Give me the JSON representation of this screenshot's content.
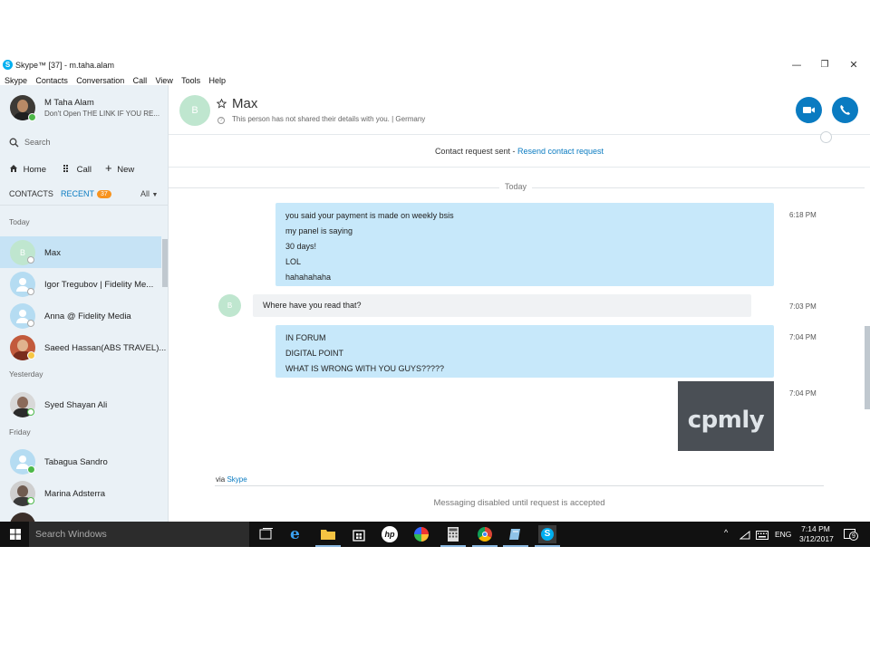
{
  "window": {
    "title": "Skype™ [37] - m.taha.alam",
    "minimize": "—",
    "restore": "❐",
    "close": "✕"
  },
  "menu": [
    "Skype",
    "Contacts",
    "Conversation",
    "Call",
    "View",
    "Tools",
    "Help"
  ],
  "sidebar": {
    "profile_name": "M Taha Alam",
    "profile_mood": "Don't Open THE LINK IF YOU RE...",
    "search_placeholder": "Search",
    "nav": {
      "home": "Home",
      "call": "Call",
      "new": "New"
    },
    "tabs": {
      "contacts": "CONTACTS",
      "recent": "RECENT",
      "recent_count": "37",
      "filter": "All"
    },
    "sections": {
      "today": "Today",
      "yesterday": "Yesterday",
      "friday": "Friday"
    },
    "contacts": [
      {
        "name": "Max",
        "initial": "B"
      },
      {
        "name": "Igor Tregubov | Fidelity Me..."
      },
      {
        "name": "Anna @ Fidelity Media"
      },
      {
        "name": "Saeed Hassan(ABS TRAVEL)..."
      },
      {
        "name": "Syed Shayan Ali"
      },
      {
        "name": "Tabagua Sandro"
      },
      {
        "name": "Marina Adsterra"
      }
    ]
  },
  "chat": {
    "avatar_initial": "B",
    "title": "Max",
    "subtitle": "This person has not shared their details with you.  |  Germany",
    "request_text": "Contact request sent - ",
    "request_link": "Resend contact request",
    "day_label": "Today",
    "messages": [
      {
        "lines": [
          "you said your payment is made on weekly bsis",
          "my panel is saying",
          "30 days!",
          "LOL",
          "hahahahaha"
        ],
        "time": "6:18 PM"
      },
      {
        "lines": [
          "Where have you read that?"
        ],
        "time": "7:03 PM",
        "initial": "B"
      },
      {
        "lines": [
          "IN FORUM",
          "DIGITAL POINT",
          "WHAT IS WRONG WITH YOU GUYS?????"
        ],
        "time": "7:04 PM"
      },
      {
        "image_text": "cpmly",
        "time": "7:04 PM"
      }
    ],
    "via_prefix": "via ",
    "via_link": "Skype",
    "disabled_text": "Messaging disabled until request is accepted"
  },
  "taskbar": {
    "search_placeholder": "Search Windows",
    "language": "ENG",
    "time": "7:14 PM",
    "date": "3/12/2017",
    "notification_count": "9"
  },
  "colors": {
    "accent": "#0a7bc1",
    "sidebar_bg": "#eaf1f6",
    "selected_bg": "#c6e3f5",
    "my_bubble": "#c7e8fa",
    "their_bubble": "#f0f2f4",
    "online": "#4db848",
    "away": "#f7c744"
  }
}
